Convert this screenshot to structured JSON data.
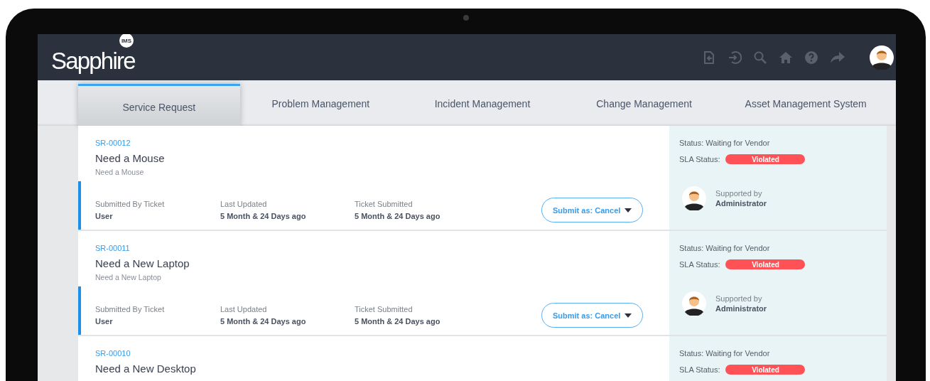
{
  "app": {
    "logo": "Sapphire",
    "logo_badge": "IMS"
  },
  "tabs": [
    {
      "label": "Service Request",
      "selected": true
    },
    {
      "label": "Problem Management",
      "selected": false
    },
    {
      "label": "Incident Management",
      "selected": false
    },
    {
      "label": "Change Management",
      "selected": false
    },
    {
      "label": "Asset Management System",
      "selected": false
    }
  ],
  "tickets": [
    {
      "id": "SR-00012",
      "title": "Need a Mouse",
      "description": "Need a Mouse",
      "fields": [
        {
          "label": "Submitted By Ticket",
          "value": "User"
        },
        {
          "label": "Last Updated",
          "value": "5 Month & 24 Days ago"
        },
        {
          "label": "Ticket Submitted",
          "value": "5 Month & 24 Days ago"
        }
      ],
      "action": "Submit as: Cancel",
      "status": "Status: Waiting for Vendor",
      "sla_label": "SLA Status:",
      "sla": "Violated",
      "support_label": "Supported by",
      "support": "Administrator"
    },
    {
      "id": "SR-00011",
      "title": "Need a New Laptop",
      "description": "Need a New Laptop",
      "fields": [
        {
          "label": "Submitted By Ticket",
          "value": "User"
        },
        {
          "label": "Last Updated",
          "value": "5 Month & 24 Days ago"
        },
        {
          "label": "Ticket Submitted",
          "value": "5 Month & 24 Days ago"
        }
      ],
      "action": "Submit as: Cancel",
      "status": "Status: Waiting for Vendor",
      "sla_label": "SLA Status:",
      "sla": "Violated",
      "support_label": "Supported by",
      "support": "Administrator"
    },
    {
      "id": "SR-00010",
      "title": "Need a New Desktop",
      "status": "Status: Waiting for Vendor",
      "sla_label": "SLA Status:",
      "sla": "Violated"
    }
  ]
}
